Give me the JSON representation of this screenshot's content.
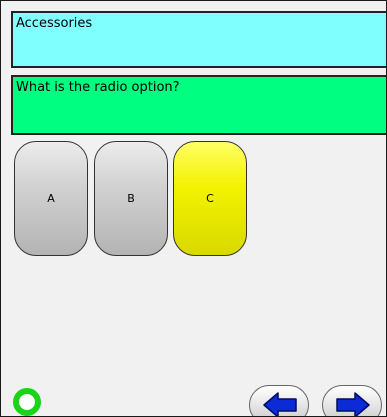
{
  "header": {
    "category": "Accessories"
  },
  "question": {
    "text": "What is the radio option?"
  },
  "options": [
    {
      "label": "A",
      "selected": false,
      "color": "#c8c8c8"
    },
    {
      "label": "B",
      "selected": false,
      "color": "#c8c8c8"
    },
    {
      "label": "C",
      "selected": true,
      "color": "#f2f200"
    }
  ],
  "status": {
    "icon": "status-ring-icon",
    "color": "#19d419"
  },
  "navigation": {
    "back_icon": "left-arrow-icon",
    "next_icon": "right-arrow-icon",
    "arrow_color": "#0a2bd6"
  }
}
